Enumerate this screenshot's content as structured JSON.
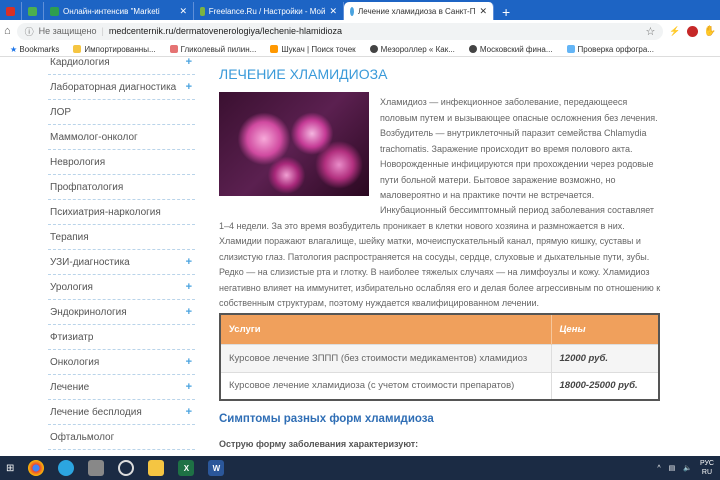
{
  "browser": {
    "tabs": [
      {
        "label": "",
        "color": "#d93025"
      },
      {
        "label": "",
        "color": "#4caf50"
      },
      {
        "label": "Онлайн-интенсив \"Marketi",
        "color": "#2e9e4f"
      },
      {
        "label": "Freelance.Ru / Настройки - Мой",
        "color": "#7cb342"
      },
      {
        "label": "Лечение хламидиоза в Санкт-П",
        "color": "#4aa3df",
        "active": true
      }
    ],
    "new_tab": "+",
    "security": "Не защищено",
    "url": "medcenternik.ru/dermatovenerologiya/lechenie-hlamidioza",
    "bookmarks": [
      "Bookmarks",
      "Импортированны...",
      "Гликолевый пилин...",
      "Шукач | Поиск точек",
      "Мезороллер « Как...",
      "Московский фина...",
      "Проверка орфогра..."
    ]
  },
  "sidebar": [
    {
      "label": "Кардиология",
      "plus": true
    },
    {
      "label": "Лабораторная диагностика",
      "plus": true
    },
    {
      "label": "ЛОР",
      "plus": false
    },
    {
      "label": "Маммолог-онколог",
      "plus": false
    },
    {
      "label": "Неврология",
      "plus": false
    },
    {
      "label": "Профпатология",
      "plus": false
    },
    {
      "label": "Психиатрия-наркология",
      "plus": false
    },
    {
      "label": "Терапия",
      "plus": false
    },
    {
      "label": "УЗИ-диагностика",
      "plus": true
    },
    {
      "label": "Урология",
      "plus": true
    },
    {
      "label": "Эндокринология",
      "plus": true
    },
    {
      "label": "Фтизиатр",
      "plus": false
    },
    {
      "label": "Онкология",
      "plus": true
    },
    {
      "label": "Лечение",
      "plus": true
    },
    {
      "label": "Лечение бесплодия",
      "plus": true
    },
    {
      "label": "Офтальмолог",
      "plus": false
    }
  ],
  "main": {
    "title": "ЛЕЧЕНИЕ ХЛАМИДИОЗА",
    "para1": "Хламидиоз — инфекционное заболевание, передающееся половым путем и вызывающее опасные осложнения без лечения. Возбудитель — внутриклеточный паразит семейства Chlamydia trachomatis. Заражение происходит во время полового акта. Новорожденные инфицируются при прохождении через родовые пути больной матери. Бытовое заражение возможно, но маловероятно и на практике почти не встречается.",
    "para2": "Инкубационный бессимптомный период заболевания составляет 1–4 недели. За это время возбудитель проникает в клетки нового хозяина и размножается в них. Хламидии поражают влагалище, шейку матки, мочеиспускательный канал, прямую кишку, суставы и слизистую глаз. Патология распространяется на сосуды, сердце, слуховые и дыхательные пути, зубы. Редко — на слизистые рта и глотку. В наиболее тяжелых случаях — на лимфоузлы и кожу. Хламидиоз негативно влияет на иммунитет, избирательно ослабляя его и делая более агрессивным по отношению к собственным структурам, поэтому нуждается квалифицированном лечении.",
    "table": {
      "headers": [
        "Услуги",
        "Цены"
      ],
      "rows": [
        [
          "Курсовое лечение ЗППП (без стоимости медикаментов) хламидиоз",
          "12000 руб."
        ],
        [
          "Курсовое лечение хламидиоза (с учетом стоимости препаратов)",
          "18000-25000 руб."
        ]
      ]
    },
    "subheading": "Симптомы разных форм хламидиоза",
    "para3": "Острую форму заболевания характеризуют:"
  },
  "taskbar": {
    "lang": "РУС",
    "region": "RU"
  }
}
